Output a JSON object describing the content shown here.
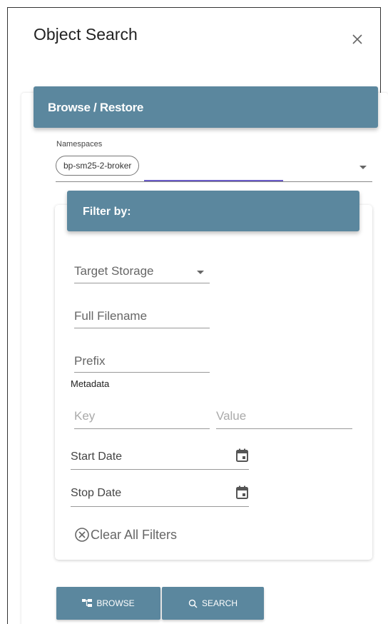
{
  "dialog": {
    "title": "Object Search",
    "close_label": "×"
  },
  "browse_section": {
    "header": "Browse / Restore",
    "namespaces_label": "Namespaces",
    "namespace_selected": "bp-sm25-2-broker"
  },
  "filter": {
    "header": "Filter by:",
    "target_storage_placeholder": "Target Storage",
    "full_filename_placeholder": "Full Filename",
    "prefix_placeholder": "Prefix",
    "metadata_label": "Metadata",
    "key_placeholder": "Key",
    "value_placeholder": "Value",
    "start_date_placeholder": "Start Date",
    "stop_date_placeholder": "Stop Date",
    "clear_all_label": "Clear All Filters"
  },
  "actions": {
    "browse_label": "BROWSE",
    "search_label": "SEARCH"
  },
  "colors": {
    "header_bg": "#5b879e",
    "focus_underline": "#6a5cc7"
  },
  "icons": {
    "close": "close-icon",
    "dropdown": "chevron-down-icon",
    "calendar": "calendar-icon",
    "clear": "circle-x-icon",
    "browse": "tree-icon",
    "search": "search-icon"
  }
}
